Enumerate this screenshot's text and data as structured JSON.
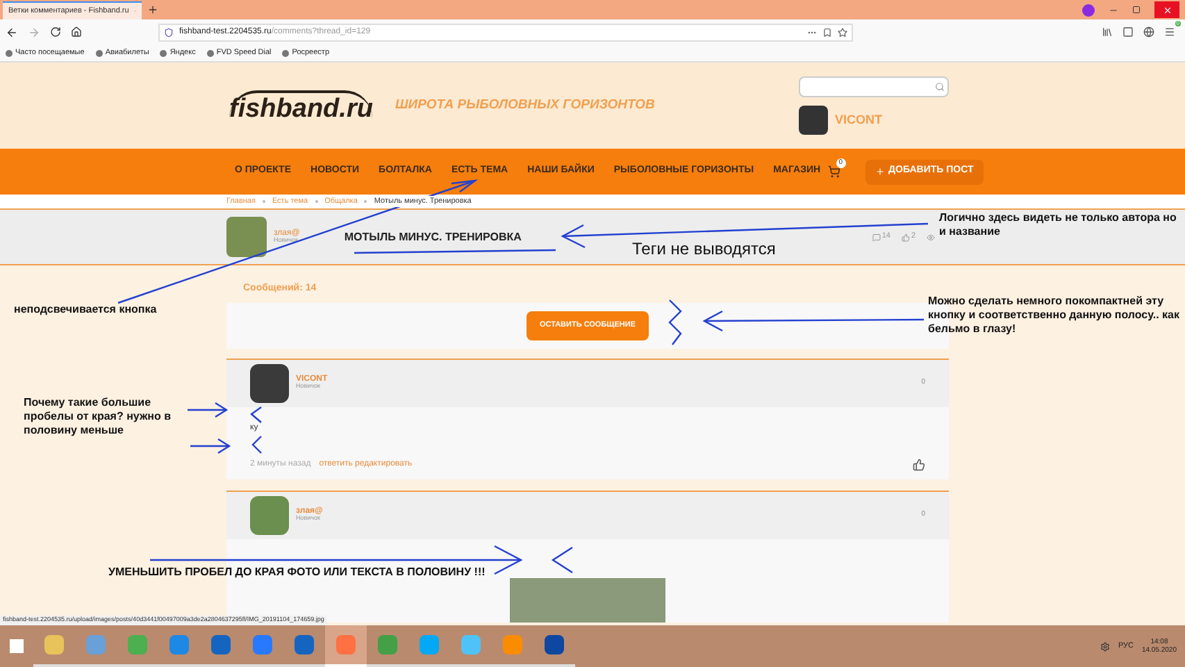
{
  "browser": {
    "tab_title": "Ветки комментариев - Fishband.ru",
    "url_host": "fishband-test.2204535.ru",
    "url_path": "/comments?thread_id=129",
    "menu_badge": "0",
    "bookmarks": [
      "Часто посещаемые",
      "Авиабилеты",
      "Яндекс",
      "FVD Speed Dial",
      "Росреестр"
    ]
  },
  "header": {
    "logo": "fishband.ru",
    "slogan": "ШИРОТА РЫБОЛОВНЫХ ГОРИЗОНТОВ",
    "user": "VICONT"
  },
  "nav": {
    "items": [
      {
        "label": "О ПРОЕКТЕ",
        "selected": false
      },
      {
        "label": "НОВОСТИ",
        "selected": false
      },
      {
        "label": "БОЛТАЛКА",
        "selected": false
      },
      {
        "label": "ЕСТЬ ТЕМА",
        "selected": false
      },
      {
        "label": "НАШИ БАЙКИ",
        "selected": false
      },
      {
        "label": "РЫБОЛОВНЫЕ ГОРИЗОНТЫ",
        "selected": false
      },
      {
        "label": "МАГАЗИН",
        "selected": false
      }
    ],
    "cart_count": "0",
    "add_post": "ДОБАВИТЬ ПОСТ"
  },
  "breadcrumbs": [
    "Главная",
    "Есть тема",
    "Общалка",
    "Мотыль минус. Тренировка"
  ],
  "thread": {
    "author": "злая@",
    "rank": "Новичок",
    "title": "МОТЫЛЬ МИНУС. ТРЕНИРОВКА",
    "comments": "14",
    "likes": "2"
  },
  "messages_count": "Сообщений: 14",
  "leave_button": "ОСТАВИТЬ СООБЩЕНИЕ",
  "posts": [
    {
      "kind": "text",
      "author": "VICONT",
      "rank": "Новичок",
      "score": "0",
      "body": "ку",
      "time": "2 минуты назад",
      "actions": "ответить редактировать"
    },
    {
      "kind": "photo",
      "author": "злая@",
      "rank": "Новичок",
      "score": "0"
    }
  ],
  "status_url": "fishband-test.2204535.ru/upload/images/posts/40d3441f00497009a3de2a2804637295fl/IMG_20191104_174659.jpg",
  "annotations": [
    {
      "text": "Логично здесь видеть не только автора но и название"
    },
    {
      "text": "Теги не выводятся"
    },
    {
      "text": "неподсвечивается кнопка"
    },
    {
      "text": "Можно сделать немного покомпактней эту кнопку и соответственно данную полосу.. как бельмо в глазу!"
    },
    {
      "text": "Почему такие большие пробелы от края? нужно в половину меньше"
    },
    {
      "text": "УМЕНЬШИТЬ ПРОБЕЛ ДО КРАЯ ФОТО ИЛИ ТЕКСТА В ПОЛОВИНУ !!!"
    }
  ],
  "taskbar": {
    "apps": [
      {
        "selected": false
      },
      {
        "selected": false
      },
      {
        "selected": false
      },
      {
        "selected": false
      },
      {
        "selected": false
      },
      {
        "selected": false
      },
      {
        "selected": false
      },
      {
        "selected": true
      },
      {
        "selected": false
      },
      {
        "selected": false
      },
      {
        "selected": false
      },
      {
        "selected": false
      },
      {
        "selected": false
      }
    ],
    "lang": "РУС",
    "time": "14:08",
    "date": "14.05.2020"
  }
}
